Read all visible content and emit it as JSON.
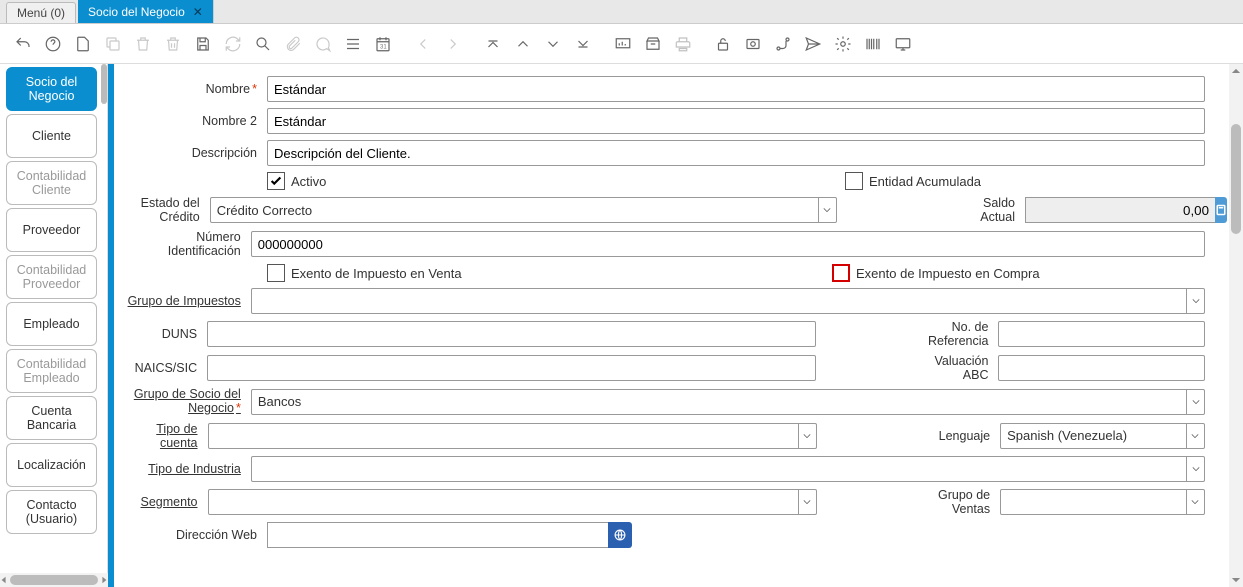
{
  "tabs": {
    "menu": "Menú (0)",
    "active": "Socio del Negocio"
  },
  "side": {
    "items": [
      {
        "label": "Socio del Negocio",
        "active": true
      },
      {
        "label": "Cliente"
      },
      {
        "label": "Contabilidad Cliente",
        "dim": true
      },
      {
        "label": "Proveedor"
      },
      {
        "label": "Contabilidad Proveedor",
        "dim": true
      },
      {
        "label": "Empleado"
      },
      {
        "label": "Contabilidad Empleado",
        "dim": true
      },
      {
        "label": "Cuenta Bancaria"
      },
      {
        "label": "Localización"
      },
      {
        "label": "Contacto (Usuario)"
      }
    ]
  },
  "form": {
    "nombre_lbl": "Nombre",
    "nombre": "Estándar",
    "nombre2_lbl": "Nombre 2",
    "nombre2": "Estándar",
    "desc_lbl": "Descripción",
    "desc": "Descripción del Cliente.",
    "activo": "Activo",
    "entidad": "Entidad Acumulada",
    "estado_lbl": "Estado del Crédito",
    "estado": "Crédito Correcto",
    "saldo_lbl": "Saldo Actual",
    "saldo": "0,00",
    "numid_lbl": "Número Identificación",
    "numid": "000000000",
    "exventa": "Exento de Impuesto en Venta",
    "excompra": "Exento de Impuesto en Compra",
    "grupoimp_lbl": "Grupo de Impuestos",
    "duns_lbl": "DUNS",
    "noref_lbl": "No. de Referencia",
    "naics_lbl": "NAICS/SIC",
    "valabc_lbl": "Valuación ABC",
    "gruposoc_lbl": "Grupo de Socio del Negocio",
    "gruposoc": "Bancos",
    "tcuenta_lbl": "Tipo de cuenta",
    "lenguaje_lbl": "Lenguaje",
    "lenguaje": "Spanish (Venezuela)",
    "tind_lbl": "Tipo de Industria",
    "seg_lbl": "Segmento",
    "grupoventas_lbl": "Grupo de Ventas",
    "web_lbl": "Dirección Web"
  }
}
